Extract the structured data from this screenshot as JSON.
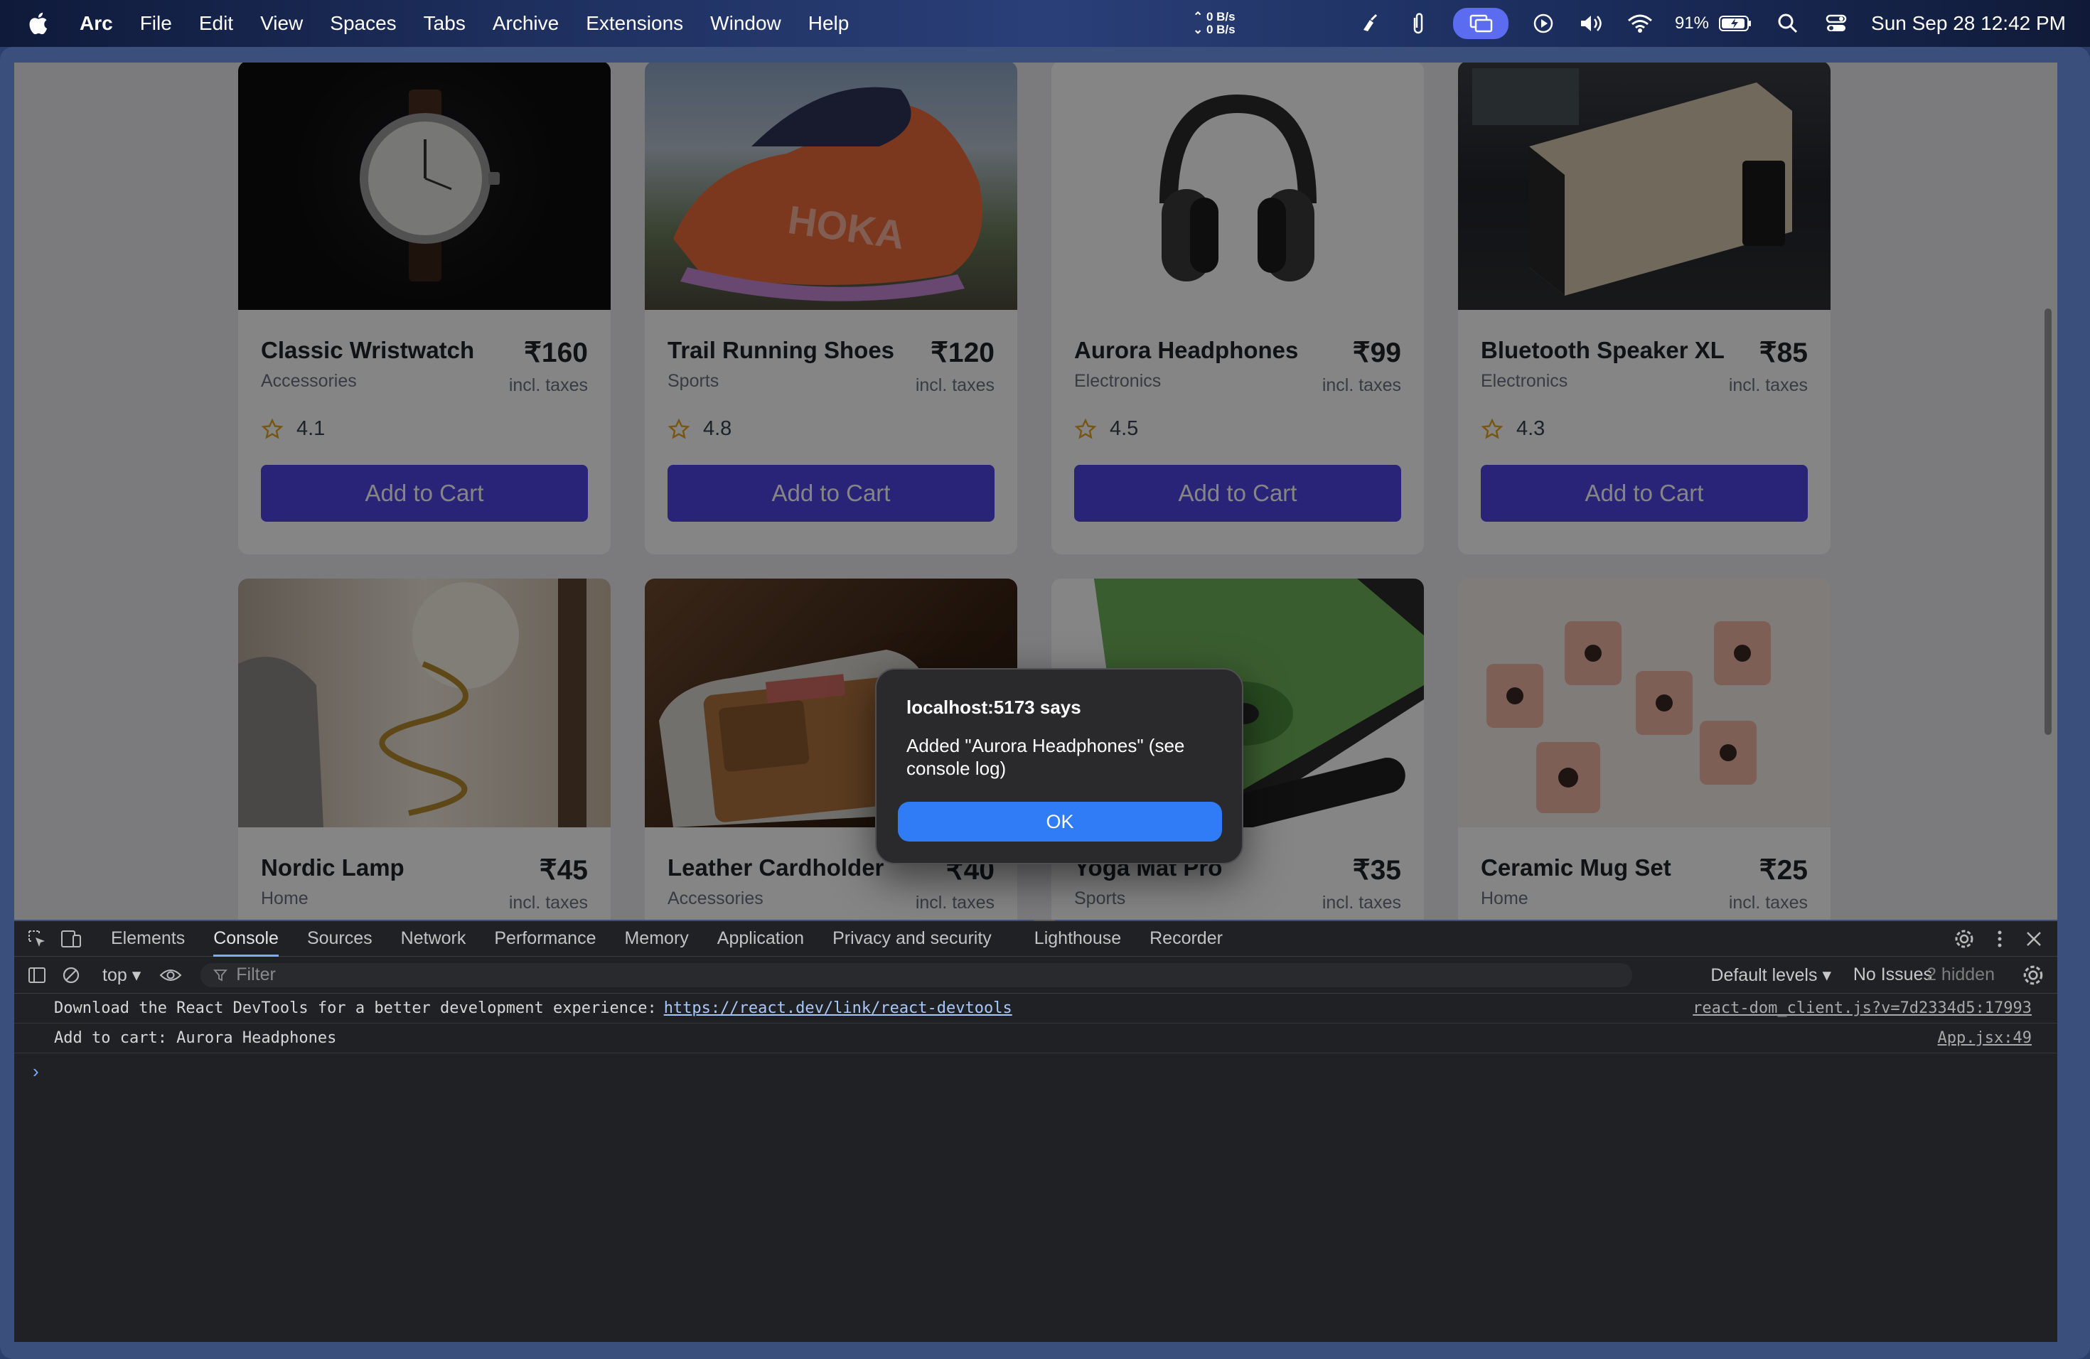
{
  "menubar": {
    "items": [
      "Arc",
      "File",
      "Edit",
      "View",
      "Spaces",
      "Tabs",
      "Archive",
      "Extensions",
      "Window",
      "Help"
    ],
    "net_up": "0 B/s",
    "net_down": "0 B/s",
    "battery": "91%",
    "clock": "Sun Sep 28  12:42 PM"
  },
  "products": [
    {
      "name": "Classic Wristwatch",
      "category": "Accessories",
      "price": "₹160",
      "tax": "incl. taxes",
      "rating": "4.1",
      "button": "Add to Cart",
      "image": "wristwatch"
    },
    {
      "name": "Trail Running Shoes",
      "category": "Sports",
      "price": "₹120",
      "tax": "incl. taxes",
      "rating": "4.8",
      "button": "Add to Cart",
      "image": "shoes"
    },
    {
      "name": "Aurora Headphones",
      "category": "Electronics",
      "price": "₹99",
      "tax": "incl. taxes",
      "rating": "4.5",
      "button": "Add to Cart",
      "image": "headphones"
    },
    {
      "name": "Bluetooth Speaker XL",
      "category": "Electronics",
      "price": "₹85",
      "tax": "incl. taxes",
      "rating": "4.3",
      "button": "Add to Cart",
      "image": "speaker"
    },
    {
      "name": "Nordic Lamp",
      "category": "Home",
      "price": "₹45",
      "tax": "incl. taxes",
      "image": "lamp"
    },
    {
      "name": "Leather Cardholder",
      "category": "Accessories",
      "price": "₹40",
      "tax": "incl. taxes",
      "image": "cardholder"
    },
    {
      "name": "Yoga Mat Pro",
      "category": "Sports",
      "price": "₹35",
      "tax": "incl. taxes",
      "image": "yoga-mat"
    },
    {
      "name": "Ceramic Mug Set",
      "category": "Home",
      "price": "₹25",
      "tax": "incl. taxes",
      "image": "mugs"
    }
  ],
  "alert": {
    "title": "localhost:5173 says",
    "message": "Added \"Aurora Headphones\" (see console log)",
    "ok_label": "OK"
  },
  "devtools": {
    "tabs": [
      "Elements",
      "Console",
      "Sources",
      "Network",
      "Performance",
      "Memory",
      "Application",
      "Privacy and security",
      "Lighthouse",
      "Recorder"
    ],
    "active_tab": "Console",
    "context": "top",
    "filter_placeholder": "Filter",
    "levels": "Default levels",
    "issues": "No Issues",
    "hidden": "2 hidden",
    "logs": [
      {
        "text": "Download the React DevTools for a better development experience:",
        "link": "https://react.dev/link/react-devtools",
        "source": "react-dom_client.js?v=7d2334d5:17993"
      },
      {
        "text": "Add to cart: Aurora Headphones",
        "link": "",
        "source": "App.jsx:49"
      }
    ],
    "prompt": "›"
  },
  "colors": {
    "accent": "#4f46e5",
    "alert_button": "#2f7cf6",
    "devtools_bg": "#202124"
  }
}
